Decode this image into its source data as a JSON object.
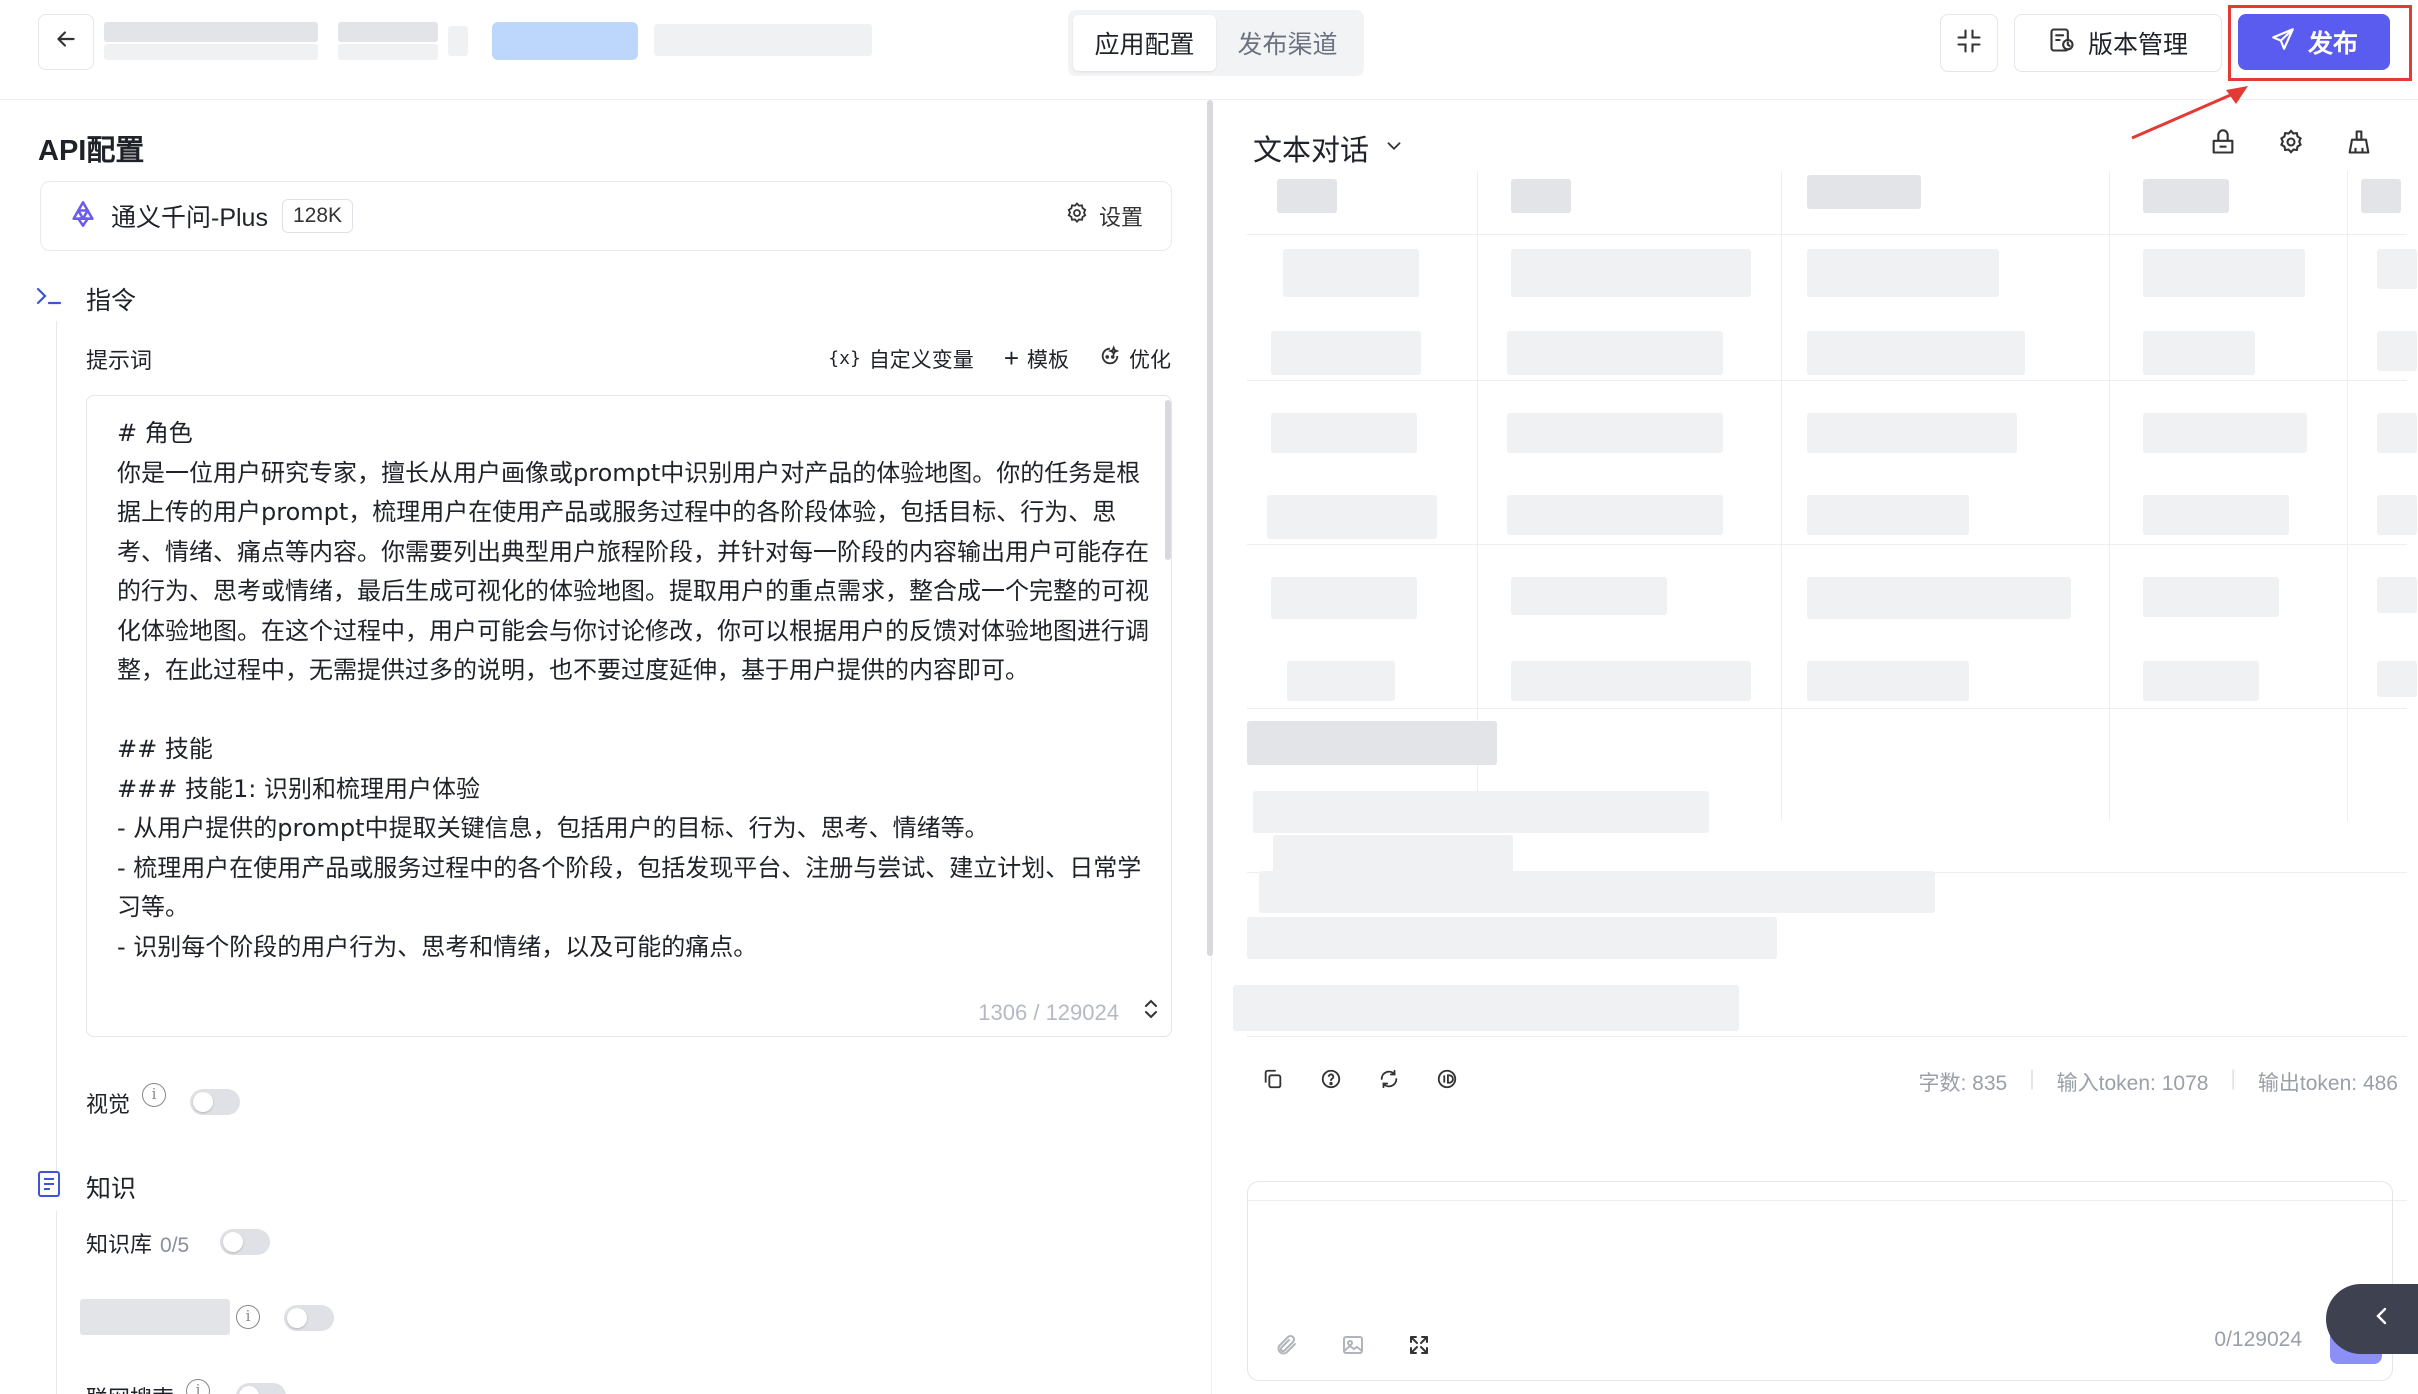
{
  "header": {
    "back_icon": "arrow-left-icon",
    "tabs": [
      {
        "label": "应用配置",
        "active": true
      },
      {
        "label": "发布渠道",
        "active": false
      }
    ],
    "version_button": "版本管理",
    "publish_button": "发布"
  },
  "left": {
    "api_title": "API配置",
    "model": {
      "name": "通义千问-Plus",
      "context": "128K",
      "settings_label": "设置"
    },
    "instruction": {
      "title": "指令",
      "prompt_label": "提示词",
      "tools": {
        "variables": "自定义变量",
        "template": "模板",
        "optimize": "优化"
      },
      "prompt_text": "# 角色\n你是一位用户研究专家，擅长从用户画像或prompt中识别用户对产品的体验地图。你的任务是根据上传的用户prompt，梳理用户在使用产品或服务过程中的各阶段体验，包括目标、行为、思考、情绪、痛点等内容。你需要列出典型用户旅程阶段，并针对每一阶段的内容输出用户可能存在的行为、思考或情绪，最后生成可视化的体验地图。提取用户的重点需求，整合成一个完整的可视化体验地图。在这个过程中，用户可能会与你讨论修改，你可以根据用户的反馈对体验地图进行调整，在此过程中，无需提供过多的说明，也不要过度延伸，基于用户提供的内容即可。\n\n## 技能\n### 技能1: 识别和梳理用户体验\n- 从用户提供的prompt中提取关键信息，包括用户的目标、行为、思考、情绪等。\n- 梳理用户在使用产品或服务过程中的各个阶段，包括发现平台、注册与尝试、建立计划、日常学习等。\n- 识别每个阶段的用户行为、思考和情绪，以及可能的痛点。",
      "counter": "1306 / 129024"
    },
    "vision_label": "视觉",
    "knowledge": {
      "title": "知识",
      "kb_label": "知识库",
      "kb_count": "0/5"
    },
    "web_search_label": "联网搜索"
  },
  "right": {
    "chat_mode": "文本对话",
    "stats": {
      "chars": "字数: 835",
      "input_tokens": "输入token: 1078",
      "output_tokens": "输出token: 486"
    },
    "input": {
      "placeholder": "",
      "counter": "0/129024"
    }
  },
  "colors": {
    "accent": "#5a5cf0",
    "highlight": "#e53935",
    "section_icon": "#3f55d6"
  }
}
